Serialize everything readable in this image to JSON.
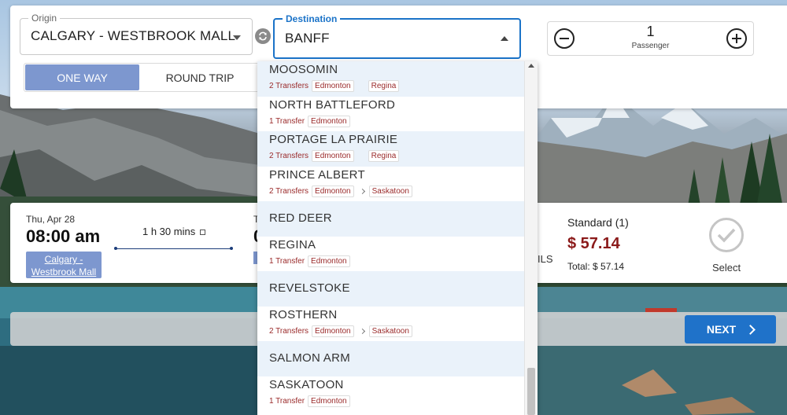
{
  "search": {
    "origin_label": "Origin",
    "origin_value": "CALGARY - WESTBROOK MALL",
    "destination_label": "Destination",
    "destination_value": "BANFF",
    "passenger_count": "1",
    "passenger_label": "Passenger",
    "trip_types": [
      {
        "label": "ONE WAY",
        "selected": true
      },
      {
        "label": "ROUND TRIP",
        "selected": false
      }
    ]
  },
  "result": {
    "departure_date": "Thu, Apr 28",
    "departure_time": "08:00 am",
    "departure_station": "Calgary - Westbrook Mall",
    "duration": "1 h 30 mins",
    "arrival_date_clipped": "T",
    "arrival_time_clipped": "0",
    "clipped_text": "ILS",
    "fare_name": "Standard (1)",
    "fare_price": "$ 57.14",
    "fare_total": "Total: $ 57.14",
    "select_label": "Select"
  },
  "footer": {
    "next_label": "NEXT"
  },
  "dropdown": {
    "items": [
      {
        "name": "MOOSOMIN",
        "transfers": "2 Transfers",
        "cities": [
          "Edmonton",
          "Regina"
        ],
        "separator": "gap"
      },
      {
        "name": "NORTH BATTLEFORD",
        "transfers": "1 Transfer",
        "cities": [
          "Edmonton"
        ],
        "separator": "none"
      },
      {
        "name": "PORTAGE LA PRAIRIE",
        "transfers": "2 Transfers",
        "cities": [
          "Edmonton",
          "Regina"
        ],
        "separator": "gap"
      },
      {
        "name": "PRINCE ALBERT",
        "transfers": "2 Transfers",
        "cities": [
          "Edmonton",
          "Saskatoon"
        ],
        "separator": "chevron"
      },
      {
        "name": "RED DEER",
        "transfers": "",
        "cities": [],
        "separator": "none"
      },
      {
        "name": "REGINA",
        "transfers": "1 Transfer",
        "cities": [
          "Edmonton"
        ],
        "separator": "none"
      },
      {
        "name": "REVELSTOKE",
        "transfers": "",
        "cities": [],
        "separator": "none"
      },
      {
        "name": "ROSTHERN",
        "transfers": "2 Transfers",
        "cities": [
          "Edmonton",
          "Saskatoon"
        ],
        "separator": "chevron"
      },
      {
        "name": "SALMON ARM",
        "transfers": "",
        "cities": [],
        "separator": "none"
      },
      {
        "name": "SASKATOON",
        "transfers": "1 Transfer",
        "cities": [
          "Edmonton"
        ],
        "separator": "none"
      }
    ]
  },
  "colors": {
    "accent": "#1f72c9",
    "toggle_selected": "#7d97cf",
    "price": "#8b1a1a",
    "transfer_text": "#9a2a2a",
    "dropdown_alt_row": "#eaf2fa"
  },
  "icons": [
    "swap-icon",
    "chevron-down-icon",
    "chevron-up-icon",
    "minus-icon",
    "plus-icon",
    "external-link-icon",
    "check-circle-icon",
    "chevron-right-icon"
  ]
}
